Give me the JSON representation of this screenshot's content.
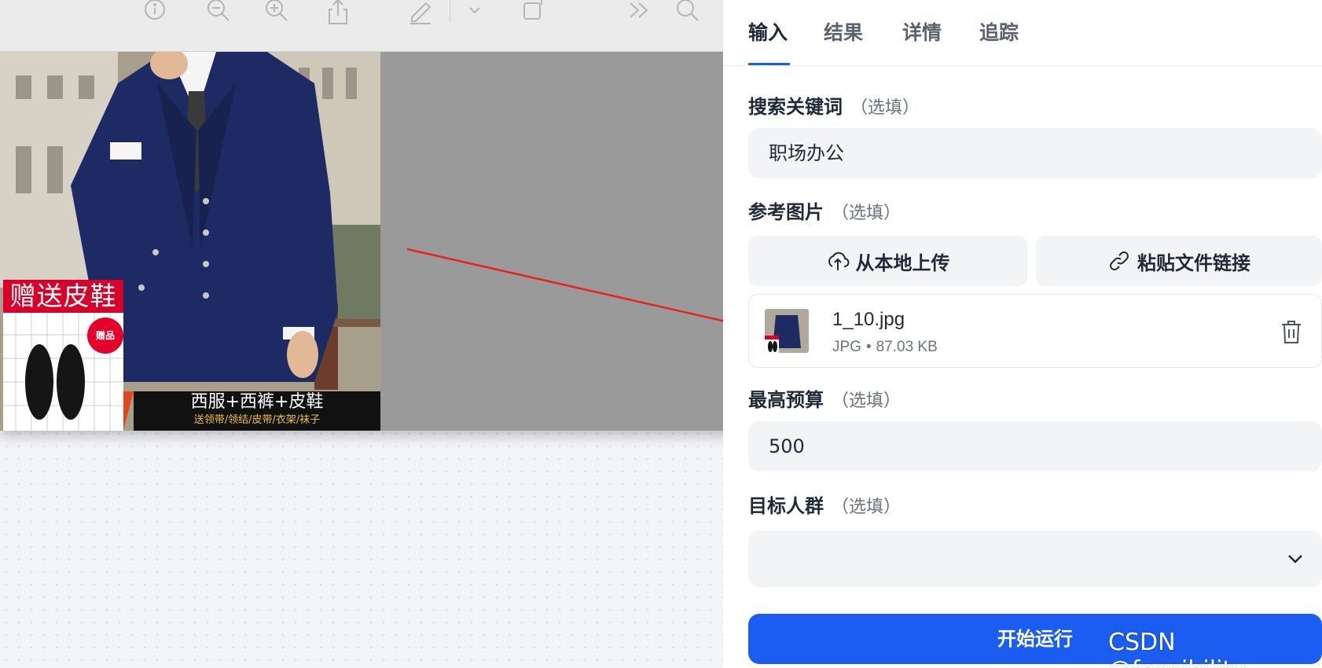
{
  "preview": {
    "toolbar_icons": [
      "info-icon",
      "zoom-out-icon",
      "zoom-in-icon",
      "share-icon",
      "markup-icon",
      "chevron-down-icon",
      "crop-icon",
      "more-icon",
      "search-icon"
    ],
    "photo": {
      "promo_banner": "赠送皮鞋",
      "gift_badge": "赠品",
      "caption_main": "西服+西裤+皮鞋",
      "caption_sub": "送领带/领结/皮带/衣架/袜子"
    }
  },
  "panel": {
    "tabs": [
      {
        "label": "输入",
        "active": true
      },
      {
        "label": "结果"
      },
      {
        "label": "详情"
      },
      {
        "label": "追踪"
      }
    ],
    "optional_suffix": "（选填）",
    "keyword": {
      "label": "搜索关键词",
      "value": "职场办公"
    },
    "reference_image": {
      "label": "参考图片",
      "upload_local": "从本地上传",
      "paste_link": "粘贴文件链接",
      "file": {
        "name": "1_10.jpg",
        "type": "JPG",
        "size": "87.03 KB"
      }
    },
    "budget": {
      "label": "最高预算",
      "value": "500"
    },
    "audience": {
      "label": "目标人群",
      "value": ""
    },
    "run_button": "开始运行"
  },
  "watermark": "CSDN @feasibility.",
  "colors": {
    "accent": "#1a5df0",
    "annotation_arrow": "#e8231b"
  }
}
